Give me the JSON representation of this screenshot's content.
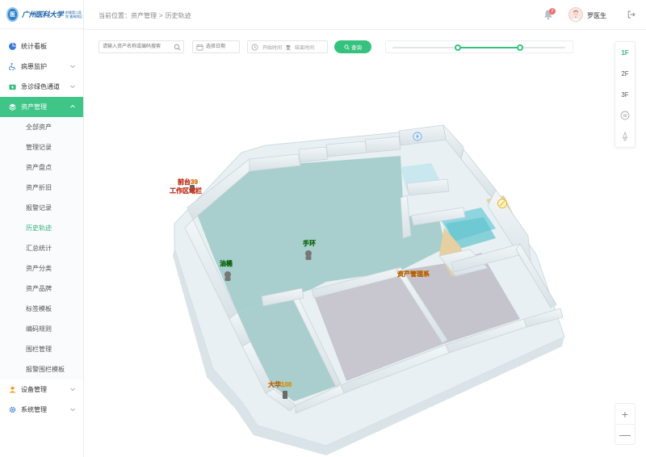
{
  "app": {
    "logo_abbr": "医",
    "logo_text": "广州医科大学",
    "logo_sub": "附属第二医院 番禺院区"
  },
  "sidebar": {
    "items": [
      {
        "label": "统计看板",
        "icon": "pie-chart-icon"
      },
      {
        "label": "病患监护",
        "icon": "wheelchair-icon"
      },
      {
        "label": "急诊绿色通道",
        "icon": "first-aid-icon"
      },
      {
        "label": "资产管理",
        "icon": "layers-icon"
      },
      {
        "label": "设备管理",
        "icon": "user-device-icon"
      },
      {
        "label": "系统管理",
        "icon": "gear-icon"
      }
    ],
    "sub_items": [
      "全部资产",
      "管理记录",
      "资产盘点",
      "资产折旧",
      "报警记录",
      "历史轨迹",
      "汇总统计",
      "资产分类",
      "资产品牌",
      "标签模板",
      "编码规则",
      "围栏管理",
      "报警围栏模板"
    ]
  },
  "header": {
    "breadcrumb": [
      "当前位置：资产管理",
      "历史轨迹"
    ],
    "breadcrumb_sep": ">",
    "notification_count": "2",
    "username": "罗医生"
  },
  "toolbar": {
    "search_placeholder": "请输入资产名称或编码搜索",
    "date_placeholder": "选择日期",
    "start_time_placeholder": "开始时间",
    "time_sep": "至",
    "end_time_placeholder": "结束时间",
    "query_label": "查询"
  },
  "timeline": {
    "start": 0.38,
    "end": 0.74
  },
  "floors": {
    "items": [
      "1F",
      "2F",
      "3F"
    ],
    "active": "1F",
    "view_3d_label": "3D"
  },
  "zoom": {
    "in_label": "+",
    "out_label": "—"
  },
  "map_labels": {
    "label_1": "前台39",
    "label_2": "工作区域栏",
    "label_3": "手环",
    "label_4": "油桶",
    "label_5": "资产管理系",
    "label_6": "大华100"
  },
  "colors": {
    "accent": "#35c27e",
    "floor": "#a9cfcf",
    "wall": "#e6ecef"
  }
}
